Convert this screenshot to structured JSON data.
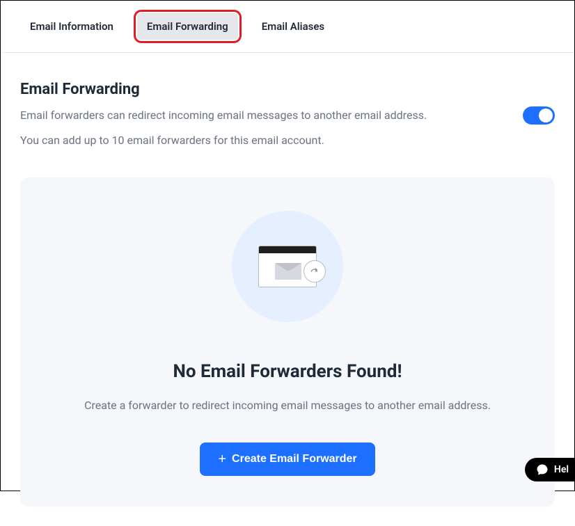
{
  "tabs": [
    {
      "label": "Email Information"
    },
    {
      "label": "Email Forwarding"
    },
    {
      "label": "Email Aliases"
    }
  ],
  "section": {
    "title": "Email Forwarding",
    "desc1": "Email forwarders can redirect incoming email messages to another email address.",
    "desc2": "You can add up to 10 email forwarders for this email account."
  },
  "empty": {
    "title": "No Email Forwarders Found!",
    "desc": "Create a forwarder to redirect incoming email messages to another email address.",
    "cta": "Create Email Forwarder"
  },
  "help": {
    "label": "Hel"
  }
}
